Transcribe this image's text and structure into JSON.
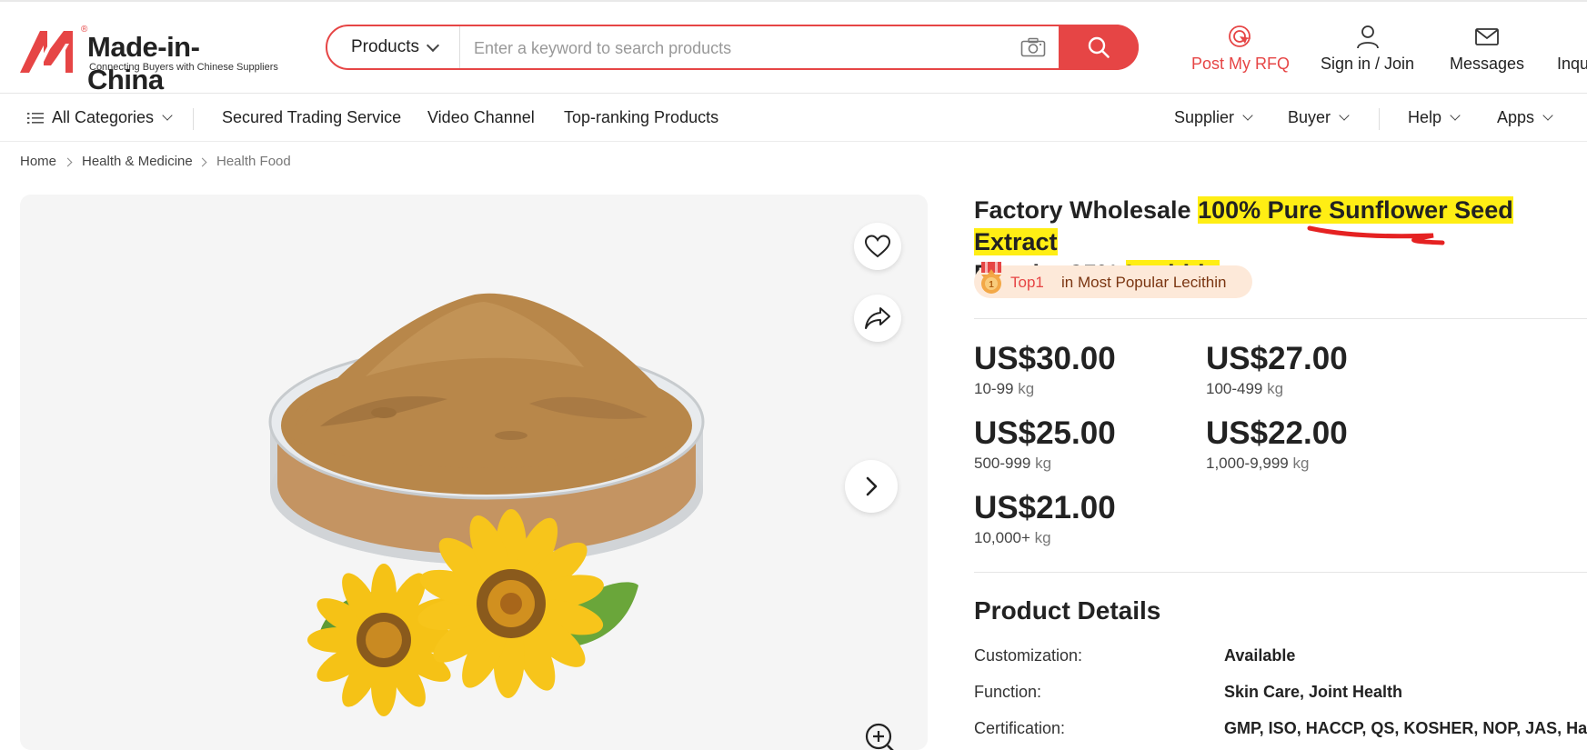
{
  "header": {
    "logo_name": "Made-in-China",
    "logo_tagline": "Connecting Buyers with Chinese Suppliers",
    "search_category": "Products",
    "search_placeholder": "Enter a keyword to search products",
    "post_rfq": "Post My RFQ",
    "sign_in": "Sign in / Join",
    "messages": "Messages",
    "inquiry": "Inqu"
  },
  "nav": {
    "all_categories": "All Categories",
    "secured_trading": "Secured Trading Service",
    "video_channel": "Video Channel",
    "top_ranking": "Top-ranking Products",
    "supplier": "Supplier",
    "buyer": "Buyer",
    "help": "Help",
    "apps": "Apps"
  },
  "breadcrumb": [
    "Home",
    "Health & Medicine",
    "Health Food"
  ],
  "product": {
    "title_plain_1": "Factory Wholesale ",
    "title_hl_1": "100% Pure Sunflower Seed Extract",
    "title_plain_2": "Powder 95% ",
    "title_hl_2": "Lecithin",
    "rank_label": "Top1",
    "rank_text": "in Most Popular Lecithin",
    "prices": [
      {
        "price": "US$30.00",
        "range": "10-99",
        "unit": "kg"
      },
      {
        "price": "US$27.00",
        "range": "100-499",
        "unit": "kg"
      },
      {
        "price": "US$25.00",
        "range": "500-999",
        "unit": "kg"
      },
      {
        "price": "US$22.00",
        "range": "1,000-9,999",
        "unit": "kg"
      },
      {
        "price": "US$21.00",
        "range": "10,000+",
        "unit": "kg"
      }
    ],
    "details_title": "Product Details",
    "details": [
      {
        "label": "Customization:",
        "value": "Available"
      },
      {
        "label": "Function:",
        "value": "Skin Care, Joint Health"
      },
      {
        "label": "Certification:",
        "value": "GMP, ISO, HACCP, QS, KOSHER, NOP, JAS, Halal"
      }
    ]
  },
  "colors": {
    "accent": "#e64545",
    "highlight": "#ffee14",
    "rank_bg": "#fde9d9",
    "powder": "#b8874a"
  }
}
